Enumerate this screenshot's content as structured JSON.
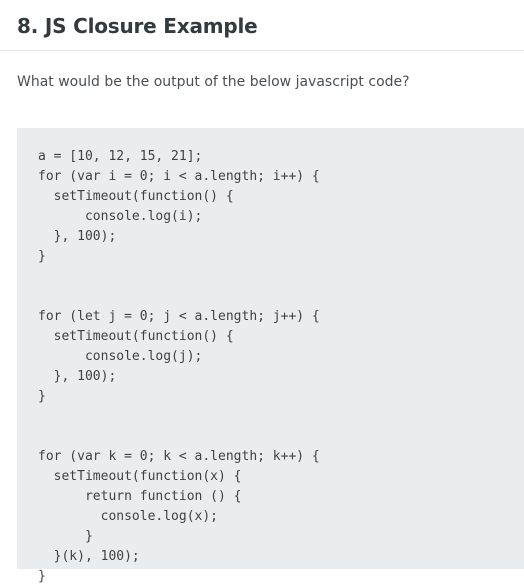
{
  "heading": {
    "title": "8. JS Closure Example"
  },
  "question": {
    "text": "What would be the output of the below javascript code?"
  },
  "code": {
    "lines": [
      "a = [10, 12, 15, 21];",
      "for (var i = 0; i < a.length; i++) {",
      "  setTimeout(function() {",
      "      console.log(i);",
      "  }, 100);",
      "}",
      "",
      "",
      "for (let j = 0; j < a.length; j++) {",
      "  setTimeout(function() {",
      "      console.log(j);",
      "  }, 100);",
      "}",
      "",
      "",
      "for (var k = 0; k < a.length; k++) {",
      "  setTimeout(function(x) {",
      "      return function () {",
      "        console.log(x);",
      "      }",
      "  }(k), 100);",
      "}"
    ]
  },
  "colors": {
    "code_background": "#eaedf0",
    "title_text": "#333a40",
    "body_text": "#4a4f54"
  }
}
